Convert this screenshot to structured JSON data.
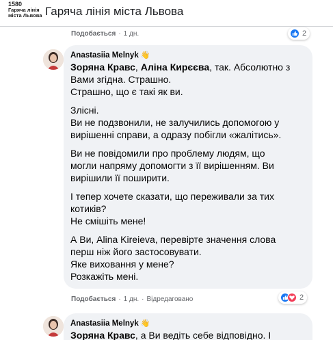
{
  "page": {
    "logo_number": "1580",
    "logo_line1": "Гаряча лінія",
    "logo_line2": "міста Львова",
    "title": "Гаряча лінія міста Львова"
  },
  "prev_comment": {
    "like_label": "Подобається",
    "time": "1 дн.",
    "reaction_count": "2"
  },
  "comment": {
    "author": "Anastasiia Melnyk",
    "author_badge_icon": "wave-hand-icon",
    "mention1": "Зоряна Кравс",
    "sep1": ", ",
    "mention2": "Аліна Кирєєва",
    "line1_rest": ", так. Абсолютно з",
    "line2": "Вами згідна. Страшно.",
    "line3": "Страшно, що є такі як ви.",
    "line4": "Злісні.",
    "line5": "Ви не подзвонили, не залучились допомогою у",
    "line6": "вирішенні справи, а одразу побігли «жалітись».",
    "line7": "Ви не повідомили про проблему людям, що",
    "line8": "могли напряму допомогти з її вирішенням. Ви",
    "line9": "вирішили її поширити.",
    "line10": "І тепер хочете сказати, що переживали за тих",
    "line11": "котиків?",
    "line12": "Не смішіть мене!",
    "line13": "А Ви, Alina Kireieva, перевірте значення слова",
    "line14": "перш ніж його застосовувати.",
    "line15": "Яке виховання у мене?",
    "line16": "Розкажіть мені.",
    "like_label": "Подобається",
    "time": "1 дн.",
    "edited": "Відредаговано",
    "reaction_count": "2"
  },
  "next_comment": {
    "author": "Anastasiia Melnyk",
    "mention": "Зоряна Кравс",
    "text_rest": ", а Ви ведіть себе відповідно. І"
  },
  "colors": {
    "like_blue": "#1877f2",
    "love_red": "#f33e58",
    "bubble_bg": "#f0f2f5",
    "meta_gray": "#65676b",
    "logo_red": "#e02b2b"
  }
}
